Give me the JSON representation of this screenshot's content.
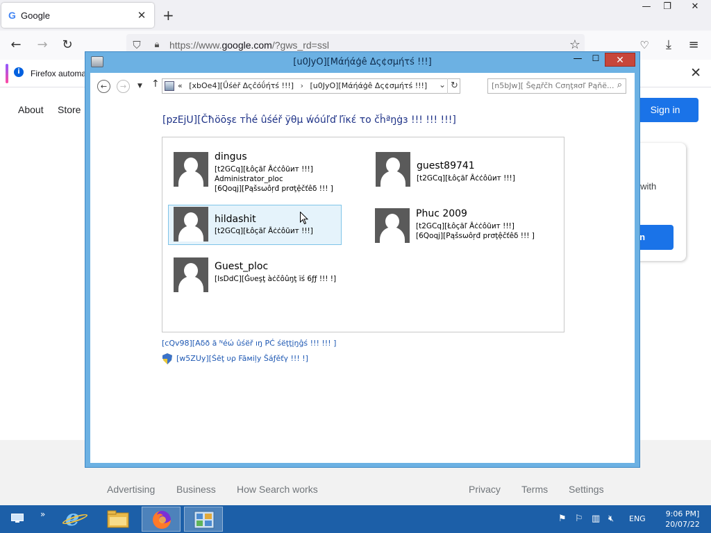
{
  "browser": {
    "tab_title": "Google",
    "tab_icon": "G",
    "url_prefix": "https://www.",
    "url_domain": "google.com",
    "url_suffix": "/?gws_rd=ssl",
    "notice_text": "Firefox automa"
  },
  "google": {
    "about": "About",
    "store": "Store",
    "sign_in": "Sign in",
    "card_text": "y with",
    "card_button": "n in",
    "footer": {
      "advertising": "Advertising",
      "business": "Business",
      "how_search_works": "How Search works",
      "privacy": "Privacy",
      "terms": "Terms",
      "settings": "Settings"
    }
  },
  "window": {
    "title": "[u0JyO][Мάήάģê Δς¢σμήτś !!!]",
    "breadcrumb_chevrons": "«",
    "breadcrumb_parent": "[xbOe4][Ǘśėř Δςĉόΰήτś !!!]",
    "breadcrumb_separator": "›",
    "breadcrumb_current": "[u0JyO][Мάήάģê Δς¢σμήτś !!!]",
    "search_placeholder": "[n5bJw][ Šęдřčh Cσηţяσľ Pąňё...",
    "heading": "[pzEjU][Čħöōşε тĥé ûśéř ÿθμ ẃóúľď ľïκέ το čĥªŋġз !!! !!! !!!]",
    "accounts": [
      {
        "name": "dingus",
        "lines": [
          "[t2GCq][Łôçăľ Ȃċċôũит !!!]",
          "Administrator_ploc",
          "[6Qoqj][Ρąšsωôŗđ prσţệčťêδ !!! ]"
        ]
      },
      {
        "name": "guest89741",
        "lines": [
          "[t2GCq][Łôçăľ Ȃċċôũит !!!]"
        ]
      },
      {
        "name": "hildashit",
        "lines": [
          "[t2GCq][Łôçăľ Ȃċċôũит !!!]"
        ]
      },
      {
        "name": "Phuc 2009",
        "lines": [
          "[t2GCq][Łôçăľ Ȃċċôũит !!!]",
          "[6Qoqj][Ρąšsωôŗđ prσţệčťêδ !!! ]"
        ]
      },
      {
        "name": "Guest_ploc",
        "lines": [
          "[IsDdC][Ġυеşţ àċčôûŋţ ïś 6ƒƒ !!! !]"
        ]
      }
    ],
    "add_user_link": "[cQv98][Αδð ā ᴺéώ ûśëř ıŋ PĆ śёţţįŋĝś !!! !!! ]",
    "family_safety_link": "[w5ZUy][Śēţ υρ Fāмiļy Ŝáƒěťγ !!! !]"
  },
  "taskbar": {
    "language": "ENG",
    "time": "9:06 ΡM]",
    "date": "20/07/22"
  },
  "colors": {
    "window_frame": "#6cb1e3",
    "close_button": "#c7463a",
    "heading_blue": "#1e3287",
    "link_blue": "#1e58b3",
    "taskbar": "#1c5fa8",
    "google_blue": "#1a73e8",
    "selection_fill": "#e5f3fb"
  }
}
